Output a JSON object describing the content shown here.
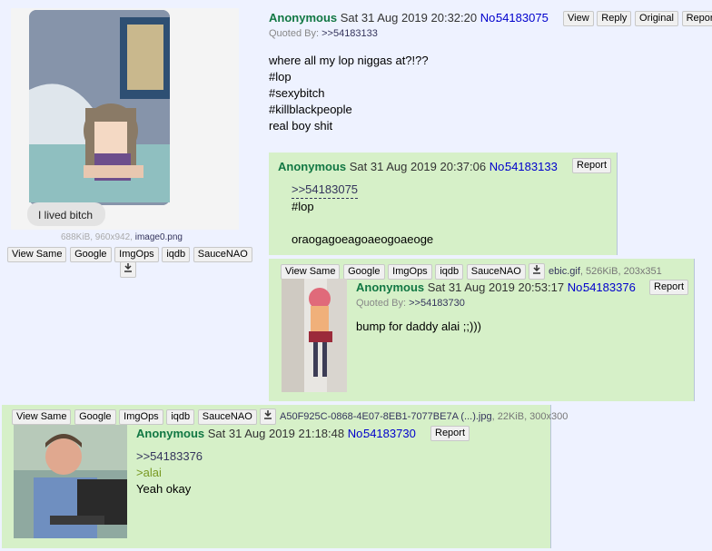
{
  "op": {
    "name": "Anonymous",
    "datetime": "Sat 31 Aug 2019 20:32:20",
    "no_label": "No.",
    "no": "54183075",
    "actions": [
      "View",
      "Reply",
      "Original",
      "Report"
    ],
    "quoted_by_label": "Quoted By:",
    "quoted_by": ">>54183133",
    "image_caption": "I lived bitch",
    "file_info": "688KiB, 960x942,",
    "file_name": "image0.png",
    "image_tools": [
      "View Same",
      "Google",
      "ImgOps",
      "iqdb",
      "SauceNAO"
    ],
    "lines": [
      "where all my lop niggas at?!??",
      "#lop",
      "#sexybitch",
      "#killblackpeople",
      "real boy shit"
    ]
  },
  "reply1": {
    "name": "Anonymous",
    "datetime": "Sat 31 Aug 2019 20:37:06",
    "no_label": "No.",
    "no": "54183133",
    "report": "Report",
    "quote": ">>54183075",
    "line1": "#lop",
    "line2": "oraogagoeagoaeogoaeoge"
  },
  "reply2": {
    "image_tools": [
      "View Same",
      "Google",
      "ImgOps",
      "iqdb",
      "SauceNAO"
    ],
    "file_name": "ebic.gif",
    "file_info": ", 526KiB, 203x351",
    "name": "Anonymous",
    "datetime": "Sat 31 Aug 2019 20:53:17",
    "no_label": "No.",
    "no": "54183376",
    "report": "Report",
    "quoted_by_label": "Quoted By:",
    "quoted_by": ">>54183730",
    "text": "bump for daddy alai ;;)))"
  },
  "reply3": {
    "image_tools": [
      "View Same",
      "Google",
      "ImgOps",
      "iqdb",
      "SauceNAO"
    ],
    "file_name": "A50F925C-0868-4E07-8EB1-7077BE7A (...).jpg",
    "file_info": ", 22KiB, 300x300",
    "name": "Anonymous",
    "datetime": "Sat 31 Aug 2019 21:18:48",
    "no_label": "No.",
    "no": "54183730",
    "report": "Report",
    "quote": ">>54183376",
    "greentext": ">alai",
    "text": "Yeah okay"
  },
  "colors": {
    "name": "#117743",
    "reply_bg": "#d6f0c8",
    "greentext": "#789922",
    "quotelink": "#34345c"
  },
  "icons": [
    "download-icon"
  ]
}
